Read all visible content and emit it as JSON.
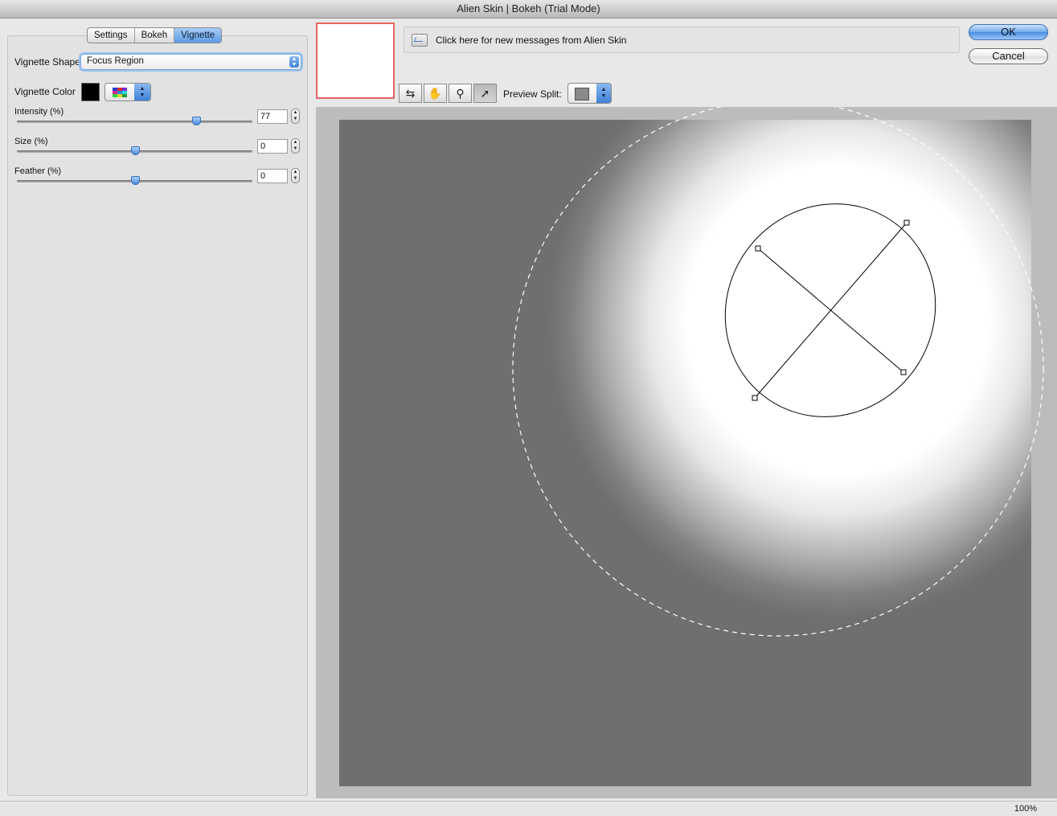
{
  "window": {
    "title": "Alien Skin | Bokeh (Trial Mode)"
  },
  "tabs": [
    {
      "label": "Settings",
      "active": false
    },
    {
      "label": "Bokeh",
      "active": false
    },
    {
      "label": "Vignette",
      "active": true
    }
  ],
  "vignette": {
    "shape_label": "Vignette Shape",
    "shape_value": "Focus Region",
    "color_label": "Vignette Color",
    "color_value": "#000000",
    "intensity": {
      "label": "Intensity (%)",
      "value": "77",
      "fraction": 0.76
    },
    "size": {
      "label": "Size (%)",
      "value": "0",
      "fraction": 0.5
    },
    "feather": {
      "label": "Feather (%)",
      "value": "0",
      "fraction": 0.5
    }
  },
  "messages": {
    "text": "Click here for new messages from Alien Skin",
    "icon": "message-icon"
  },
  "buttons": {
    "ok": "OK",
    "cancel": "Cancel"
  },
  "toolbar": {
    "tools": [
      {
        "name": "compare-tool",
        "icon": "compare-icon",
        "glyph": "⇆",
        "active": false
      },
      {
        "name": "hand-tool",
        "icon": "hand-icon",
        "glyph": "✋",
        "active": false
      },
      {
        "name": "zoom-tool",
        "icon": "magnifier-icon",
        "glyph": "⚲",
        "active": false
      },
      {
        "name": "select-tool",
        "icon": "arrow-pointer-icon",
        "glyph": "➚",
        "active": true
      }
    ],
    "preview_split_label": "Preview Split:"
  },
  "status": {
    "zoom": "100%"
  }
}
